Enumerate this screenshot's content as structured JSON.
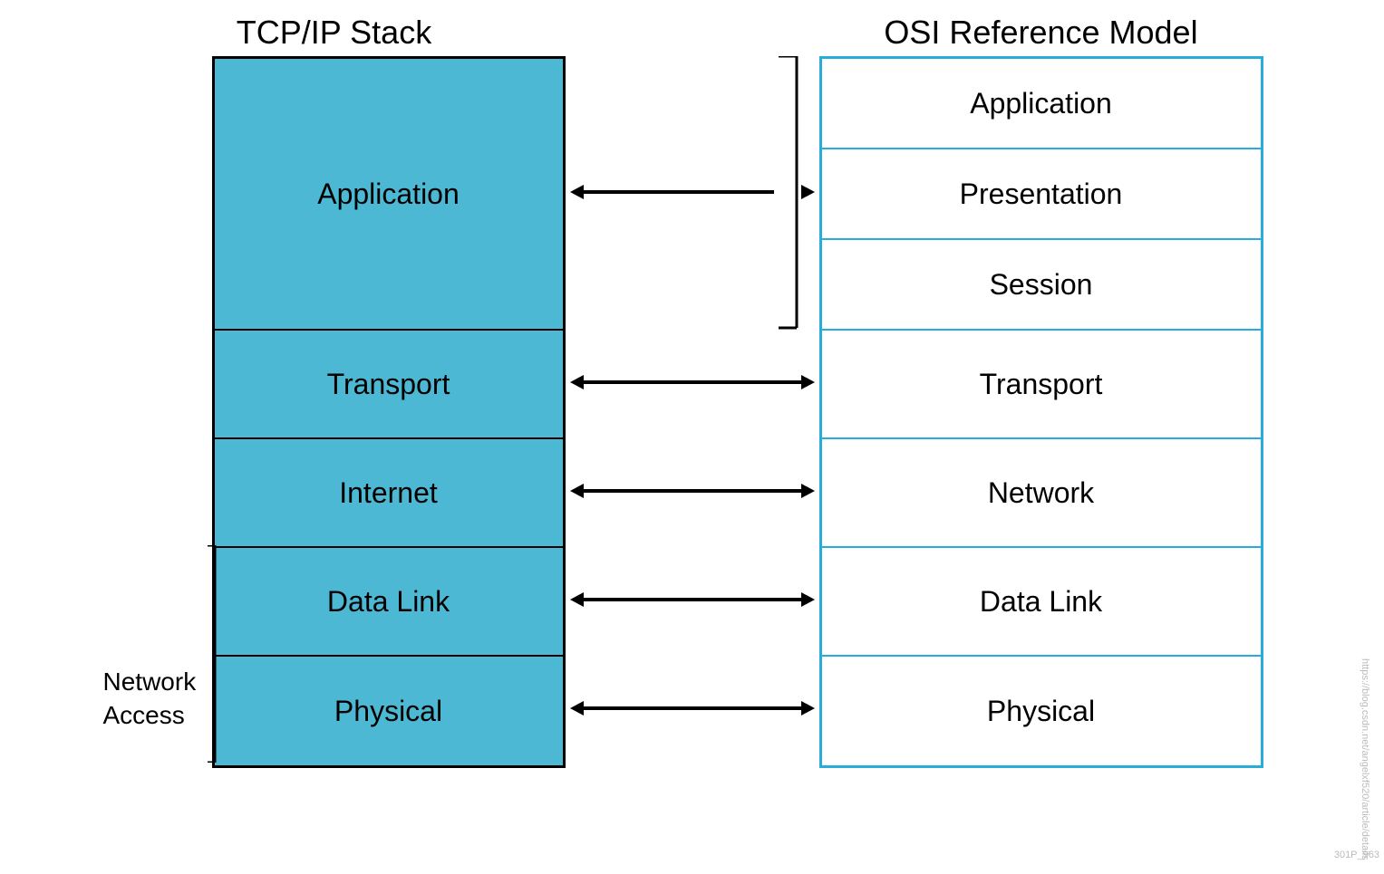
{
  "titles": {
    "tcpip": "TCP/IP Stack",
    "osi": "OSI Reference Model"
  },
  "tcpip_layers": [
    {
      "id": "tcp-application",
      "label": "Application",
      "class": "tcp-app"
    },
    {
      "id": "tcp-transport",
      "label": "Transport",
      "class": "tcp-transport"
    },
    {
      "id": "tcp-internet",
      "label": "Internet",
      "class": "tcp-internet"
    },
    {
      "id": "tcp-datalink",
      "label": "Data Link",
      "class": "tcp-datalink"
    },
    {
      "id": "tcp-physical",
      "label": "Physical",
      "class": "tcp-physical"
    }
  ],
  "osi_layers": [
    {
      "id": "osi-application",
      "label": "Application",
      "class": "osi-app"
    },
    {
      "id": "osi-presentation",
      "label": "Presentation",
      "class": "osi-presentation"
    },
    {
      "id": "osi-session",
      "label": "Session",
      "class": "osi-session"
    },
    {
      "id": "osi-transport",
      "label": "Transport",
      "class": "osi-transport"
    },
    {
      "id": "osi-network",
      "label": "Network",
      "class": "osi-network"
    },
    {
      "id": "osi-datalink",
      "label": "Data Link",
      "class": "osi-datalink"
    },
    {
      "id": "osi-physical",
      "label": "Physical",
      "class": "osi-physical"
    }
  ],
  "network_access_label": "Network\nAccess",
  "colors": {
    "tcp_bg": "#4db8d4",
    "osi_border": "#29acd9",
    "arrow": "#000000",
    "bracket": "#000000"
  },
  "watermark": "https://blog.csdn.net/angelxf520/article/details",
  "figure_id": "301P_963"
}
